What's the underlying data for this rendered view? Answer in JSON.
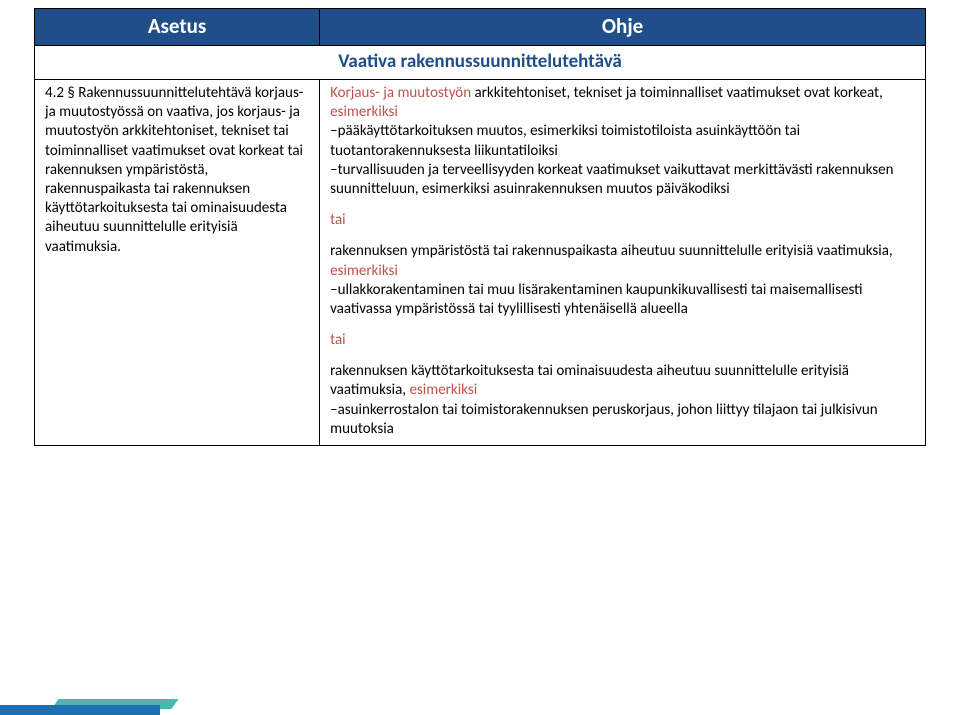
{
  "header": {
    "left": "Asetus",
    "right": "Ohje"
  },
  "section_title": "Vaativa rakennussuunnittelutehtävä",
  "left_col": {
    "para": "4.2 § Rakennussuunnittelutehtävä korjaus- ja muutostyössä on vaativa, jos korjaus- ja muutostyön arkkitehtoniset, tekniset tai toiminnalliset vaatimukset ovat korkeat tai rakennuksen ympäristöstä, rakennuspaikasta tai rakennuksen käyttötarkoituksesta tai ominaisuudesta aiheutuu suunnittelulle erityisiä vaatimuksia."
  },
  "right_col": {
    "intro_hl": "Korjaus- ja muutostyön",
    "intro_rest": " arkkitehtoniset, tekniset ja toiminnalliset vaatimukset ovat korkeat,",
    "esim": " esimerkiksi",
    "bullet1": "–pääkäyttötarkoituksen muutos, esimerkiksi toimistotiloista asuinkäyttöön tai tuotantorakennuksesta liikuntatiloiksi",
    "bullet2": "–turvallisuuden ja terveellisyyden korkeat vaatimukset vaikuttavat merkittävästi rakennuksen suunnitteluun, esimerkiksi asuinrakennuksen muutos päiväkodiksi",
    "tai": "tai",
    "block2_text": "rakennuksen ympäristöstä tai rakennuspaikasta aiheutuu suunnittelulle erityisiä vaatimuksia,",
    "block2_esim": " esimerkiksi",
    "block2_bullet": "–ullakkorakentaminen tai muu lisärakentaminen kaupunkikuvallisesti tai maisemallisesti vaativassa ympäristössä tai tyylillisesti yhtenäisellä alueella",
    "block3_text": "rakennuksen käyttötarkoituksesta tai ominaisuudesta aiheutuu suunnittelulle erityisiä vaatimuksia,",
    "block3_esim": " esimerkiksi",
    "block3_bullet": "–asuinkerrostalon tai toimistorakennuksen peruskorjaus, johon liittyy tilajaon tai julkisivun muutoksia"
  }
}
